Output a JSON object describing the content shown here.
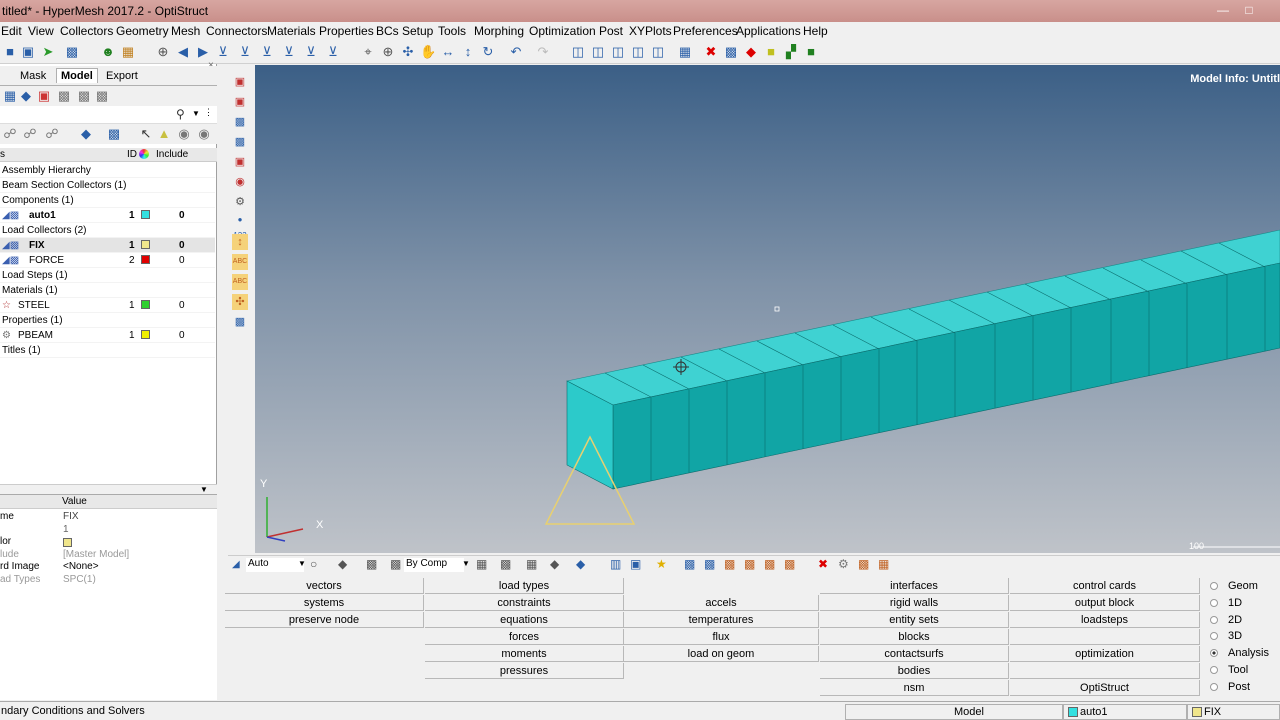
{
  "window": {
    "title": "titled* - HyperMesh 2017.2 - OptiStruct"
  },
  "menu": [
    "Edit",
    "View",
    "Collectors",
    "Geometry",
    "Mesh",
    "Connectors",
    "Materials",
    "Properties",
    "BCs",
    "Setup",
    "Tools",
    "Morphing",
    "Optimization",
    "Post",
    "XYPlots",
    "Preferences",
    "Applications",
    "Help"
  ],
  "tabs": {
    "mask": "Mask",
    "model": "Model",
    "export": "Export"
  },
  "tree": {
    "header": {
      "name": "s",
      "id": "ID",
      "include": "Include"
    },
    "rows": [
      {
        "label": "Assembly Hierarchy"
      },
      {
        "label": "Beam Section Collectors (1)"
      },
      {
        "label": "Components (1)"
      },
      {
        "label": "auto1",
        "id": "1",
        "color": "#33e0e0",
        "include": "0"
      },
      {
        "label": "Load Collectors (2)"
      },
      {
        "label": "FIX",
        "id": "1",
        "color": "#f0e68c",
        "include": "0"
      },
      {
        "label": "FORCE",
        "id": "2",
        "color": "#e00000",
        "include": "0"
      },
      {
        "label": "Load Steps (1)"
      },
      {
        "label": "Materials (1)"
      },
      {
        "label": "STEEL",
        "id": "1",
        "color": "#30d030",
        "include": "0"
      },
      {
        "label": "Properties (1)"
      },
      {
        "label": "PBEAM",
        "id": "1",
        "color": "#f0f000",
        "include": "0"
      },
      {
        "label": "Titles (1)"
      }
    ]
  },
  "props": {
    "header": {
      "name": "",
      "value": "Value"
    },
    "rows": [
      {
        "name": "me",
        "value": "FIX"
      },
      {
        "name": "",
        "value": "1"
      },
      {
        "name": "lor",
        "value": ""
      },
      {
        "name": "lude",
        "value": "[Master Model]"
      },
      {
        "name": "rd Image",
        "value": "<None>"
      },
      {
        "name": "ad Types",
        "value": "SPC(1)"
      }
    ]
  },
  "viewport": {
    "model_info": "Model Info: Untitl",
    "axis_y": "Y",
    "axis_x": "X",
    "scale": "100"
  },
  "view_toolbar": {
    "auto": "Auto",
    "bycomp": "By Comp"
  },
  "panels": {
    "col1": [
      "vectors",
      "systems",
      "preserve node"
    ],
    "col2": [
      "load types",
      "constraints",
      "equations",
      "forces",
      "moments",
      "pressures"
    ],
    "col3": [
      "accels",
      "temperatures",
      "flux",
      "load on geom"
    ],
    "col4": [
      "interfaces",
      "rigid walls",
      "entity sets",
      "blocks",
      "contactsurfs",
      "bodies",
      "nsm"
    ],
    "col5": [
      "control cards",
      "output block",
      "loadsteps",
      "optimization",
      "OptiStruct"
    ]
  },
  "radios": [
    {
      "label": "Geom",
      "on": false
    },
    {
      "label": "1D",
      "on": false
    },
    {
      "label": "2D",
      "on": false
    },
    {
      "label": "3D",
      "on": false
    },
    {
      "label": "Analysis",
      "on": true
    },
    {
      "label": "Tool",
      "on": false
    },
    {
      "label": "Post",
      "on": false
    }
  ],
  "status": {
    "left": "ndary Conditions and Solvers",
    "model": "Model",
    "comp": "auto1",
    "comp_color": "#33e0e0",
    "lc": "FIX",
    "lc_color": "#f0e68c"
  }
}
